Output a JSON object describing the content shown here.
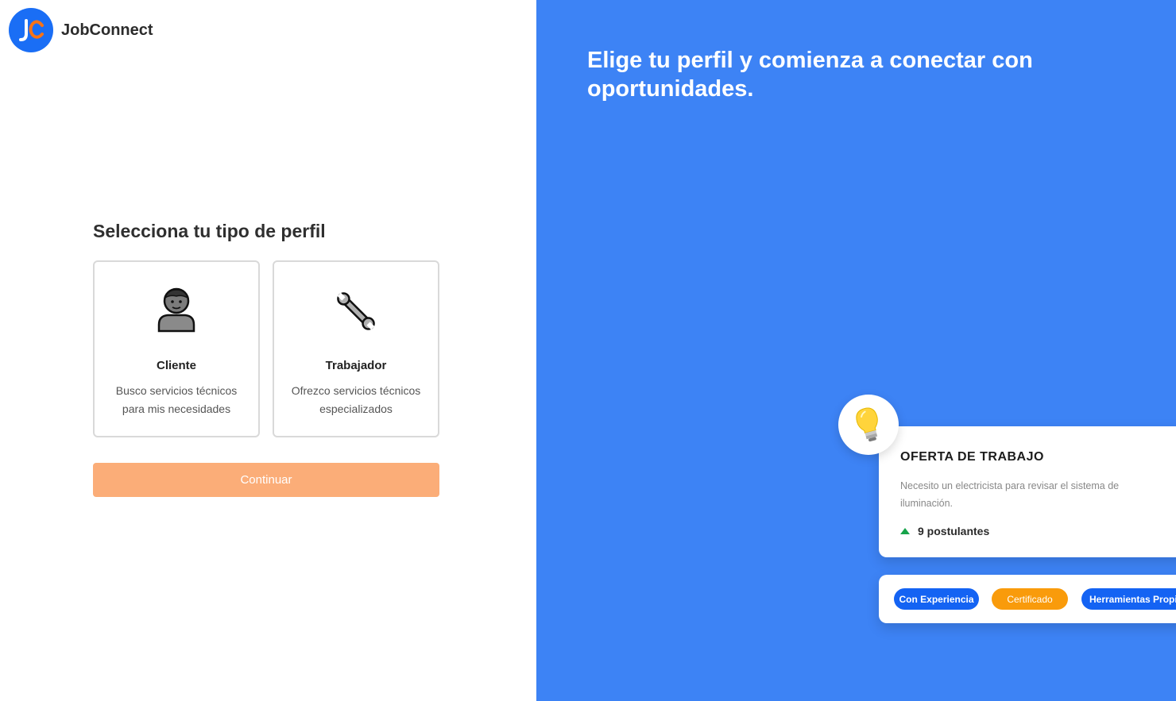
{
  "brand": {
    "name": "JobConnect",
    "logo_initials": "JC"
  },
  "profile_selection": {
    "title": "Selecciona tu tipo de perfil",
    "cards": [
      {
        "title": "Cliente",
        "description": "Busco servicios técnicos para mis necesidades",
        "icon": "person-icon"
      },
      {
        "title": "Trabajador",
        "description": "Ofrezco servicios técnicos especializados",
        "icon": "wrench-icon"
      }
    ],
    "continue_label": "Continuar"
  },
  "hero": {
    "headline": "Elige tu perfil y comienza a conectar con oportunidades.",
    "offer_card": {
      "icon": "lightbulb-icon",
      "title": "OFERTA DE TRABAJO",
      "description": "Necesito un electricista para revisar el sistema de iluminación.",
      "stat": "9 postulantes"
    },
    "tags": [
      "Con Experiencia",
      "Certificado",
      "Herramientas Propias"
    ]
  },
  "colors": {
    "brand_blue": "#1a6ef5",
    "hero_background": "#3d83f5",
    "continue_button": "#fbad78",
    "tag_blue": "#1463f3",
    "tag_orange": "#f99b0b",
    "stat_green": "#16a34a"
  }
}
